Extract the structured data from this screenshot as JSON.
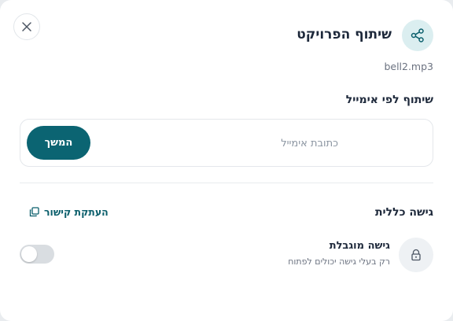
{
  "dialog": {
    "title": "שיתוף הפרויקט",
    "filename": "bell2.mp3",
    "close_icon": "close-icon",
    "share_icon": "share-icon"
  },
  "email_share": {
    "heading": "שיתוף לפי אימייל",
    "placeholder": "כתובת אימייל",
    "value": "",
    "continue_label": "המשך"
  },
  "general_access": {
    "heading": "גישה כללית",
    "copy_link_label": "העתקת קישור",
    "copy_icon": "copy-icon",
    "lock_icon": "lock-icon",
    "restricted_title": "גישה מוגבלת",
    "restricted_desc": "רק בעלי גישה יכולים לפתוח",
    "toggle_on": false
  },
  "colors": {
    "accent": "#0b6472",
    "share_badge_bg": "#dbeef0"
  }
}
